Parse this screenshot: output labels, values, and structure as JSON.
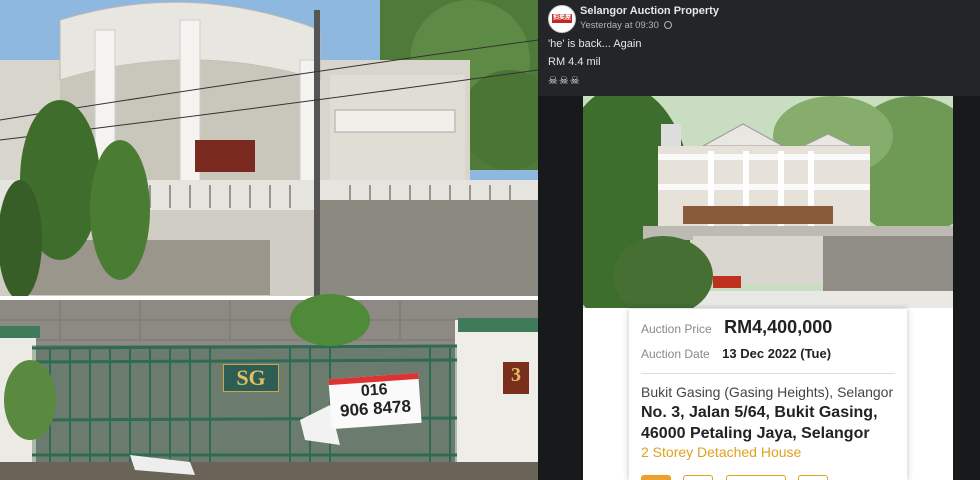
{
  "post": {
    "page_name": "Selangor Auction Property",
    "timestamp": "Yesterday at 09:30",
    "line1": "'he' is back... Again",
    "line2": "RM 4.4 mil",
    "emoji": "☠☠☠",
    "avatar_badge": "拍卖屋"
  },
  "gate": {
    "letters": "SG",
    "house_number": "3",
    "banner_line1": "016",
    "banner_line2": "906 8478"
  },
  "listing": {
    "auction_price_label": "Auction Price",
    "auction_price": "RM4,400,000",
    "auction_date_label": "Auction Date",
    "auction_date": "13 Dec 2022 (Tue)",
    "area": "Bukit Gasing (Gasing Heights), Selangor",
    "address_line1": "No. 3, Jalan 5/64, Bukit Gasing,",
    "address_line2": "46000 Petaling Jaya, Selangor",
    "property_type": "2 Storey Detached House"
  },
  "colors": {
    "accent": "#e0a020",
    "post_bg": "#242526",
    "post_text": "#e4e6eb"
  }
}
